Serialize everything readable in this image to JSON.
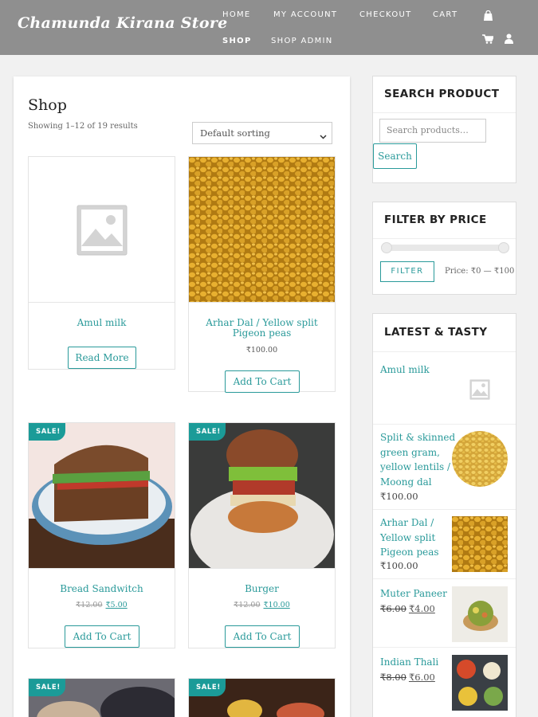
{
  "header": {
    "brand": "Chamunda Kirana Store",
    "nav": {
      "home": "HOME",
      "my_account": "MY ACCOUNT",
      "checkout": "CHECKOUT",
      "cart": "CART",
      "shop": "SHOP",
      "shop_admin": "SHOP ADMIN"
    }
  },
  "shop": {
    "title": "Shop",
    "results": "Showing 1–12 of 19 results",
    "sorting": "Default sorting",
    "products": [
      {
        "name": "Amul milk",
        "button": "Read More"
      },
      {
        "name": "Arhar Dal / Yellow split Pigeon peas",
        "price": "₹100.00",
        "button": "Add To Cart"
      },
      {
        "name": "Bread Sandwitch",
        "sale": "SALE!",
        "old_price": "₹12.00",
        "new_price": "₹5.00",
        "button": "Add To Cart"
      },
      {
        "name": "Burger",
        "sale": "SALE!",
        "old_price": "₹12.00",
        "new_price": "₹10.00",
        "button": "Add To Cart"
      },
      {
        "sale": "SALE!"
      },
      {
        "sale": "SALE!"
      }
    ]
  },
  "sidebar": {
    "search": {
      "title": "SEARCH PRODUCT",
      "placeholder": "Search products…",
      "button": "Search"
    },
    "filter": {
      "title": "FILTER BY PRICE",
      "button": "FILTER",
      "range": "Price: ₹0 — ₹100"
    },
    "latest": {
      "title": "LATEST & TASTY",
      "items": [
        {
          "name": "Amul milk"
        },
        {
          "name": "Split & skinned green gram, yellow lentils / Moong dal",
          "price": "₹100.00"
        },
        {
          "name": "Arhar Dal / Yellow split Pigeon peas",
          "price": "₹100.00"
        },
        {
          "name": "Muter Paneer",
          "old_price": "₹6.00",
          "new_price": "₹4.00"
        },
        {
          "name": "Indian Thali",
          "old_price": "₹8.00",
          "new_price": "₹6.00"
        }
      ]
    }
  },
  "colors": {
    "accent": "#2a9a9a",
    "header_bg": "#8f8f8f",
    "sale_badge": "#1b9b98"
  }
}
